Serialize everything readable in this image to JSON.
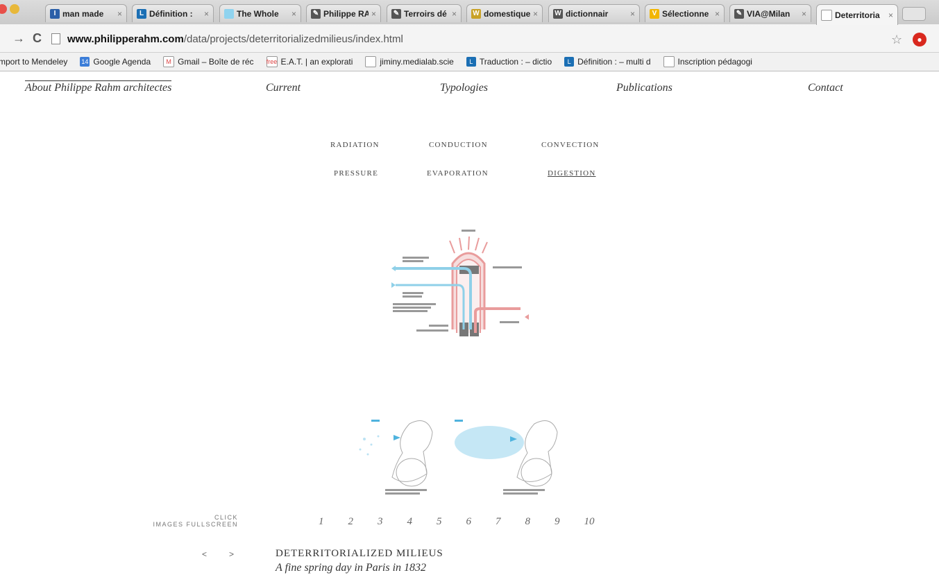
{
  "browser": {
    "tabs": [
      {
        "label": "man made",
        "icon": "kiosque-favicon",
        "color": "#2b5fa8",
        "glyph": "I"
      },
      {
        "label": "Définition :",
        "icon": "larousse-favicon",
        "color": "#1b6fb4",
        "glyph": "L"
      },
      {
        "label": "The Whole",
        "icon": "light-blue-favicon",
        "color": "#8fd3ef",
        "glyph": ""
      },
      {
        "label": "Philippe RA",
        "icon": "pen-favicon",
        "color": "#555555",
        "glyph": "✎"
      },
      {
        "label": "Terroirs dé",
        "icon": "pen-favicon",
        "color": "#555555",
        "glyph": "✎"
      },
      {
        "label": "domestique",
        "icon": "wikipedia-favicon",
        "color": "#c9a227",
        "glyph": "W"
      },
      {
        "label": "dictionnair",
        "icon": "wiktionary-favicon",
        "color": "#555555",
        "glyph": "W"
      },
      {
        "label": "Sélectionne",
        "icon": "v-favicon",
        "color": "#f2b600",
        "glyph": "V"
      },
      {
        "label": "VIA@Milan",
        "icon": "pen-favicon",
        "color": "#555555",
        "glyph": "✎"
      },
      {
        "label": "Deterritoria",
        "icon": "page-favicon",
        "color": "#ffffff",
        "glyph": "",
        "active": true
      }
    ],
    "url_host": "www.philipperahm.com",
    "url_path": "/data/projects/deterritorializedmilieus/index.html",
    "bookmarks": [
      {
        "label": "mport to Mendeley",
        "icon": ""
      },
      {
        "label": "Google Agenda",
        "icon": "calendar-icon",
        "color": "#3b7dd8",
        "glyph": "14"
      },
      {
        "label": "Gmail – Boîte de réc",
        "icon": "gmail-icon",
        "color": "#ffffff",
        "glyph": "M"
      },
      {
        "label": "E.A.T. | an explorati",
        "icon": "free-icon",
        "color": "#ffffff",
        "glyph": "free"
      },
      {
        "label": "jiminy.medialab.scie",
        "icon": "page-icon",
        "color": "#ffffff",
        "glyph": ""
      },
      {
        "label": "Traduction : – dictio",
        "icon": "larousse-icon",
        "color": "#1b6fb4",
        "glyph": "L"
      },
      {
        "label": "Définition : – multi d",
        "icon": "larousse-icon",
        "color": "#1b6fb4",
        "glyph": "L"
      },
      {
        "label": "Inscription pédagogi",
        "icon": "page-icon",
        "color": "#ffffff",
        "glyph": ""
      }
    ]
  },
  "site": {
    "nav": {
      "about": "About Philippe Rahm architectes",
      "current": "Current",
      "typologies": "Typologies",
      "publications": "Publications",
      "contact": "Contact"
    },
    "categories": {
      "radiation": "RADIATION",
      "conduction": "CONDUCTION",
      "convection": "CONVECTION",
      "pressure": "PRESSURE",
      "evaporation": "EVAPORATION",
      "digestion": "DIGESTION"
    },
    "click_line1": "CLICK",
    "click_line2": "IMAGES FULLSCREEN",
    "pages": [
      "1",
      "2",
      "3",
      "4",
      "5",
      "6",
      "7",
      "8",
      "9",
      "10"
    ],
    "prev": "<",
    "next": ">",
    "project_title": "DETERRITORIALIZED MILIEUS",
    "project_subtitle": "A fine spring day in Paris in 1832"
  }
}
